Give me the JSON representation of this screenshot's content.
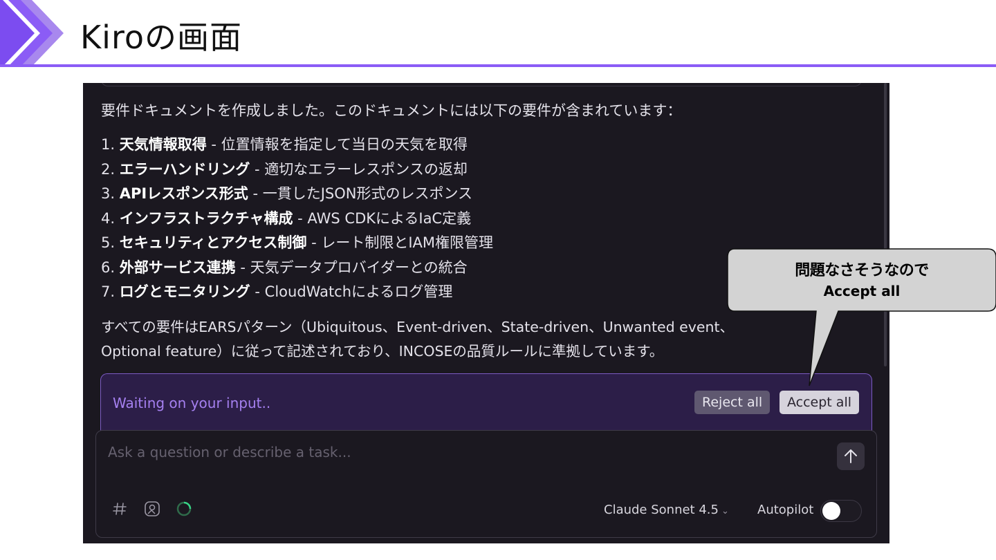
{
  "slide": {
    "title": "Kiroの画面",
    "accent_color": "#8b5cf6"
  },
  "chat": {
    "intro": "要件ドキュメントを作成しました。このドキュメントには以下の要件が含まれています：",
    "requirements": [
      {
        "num": "1.",
        "title": "天気情報取得",
        "desc": " - 位置情報を指定して当日の天気を取得"
      },
      {
        "num": "2.",
        "title": "エラーハンドリング",
        "desc": " - 適切なエラーレスポンスの返却"
      },
      {
        "num": "3.",
        "title": "APIレスポンス形式",
        "desc": " - 一貫したJSON形式のレスポンス"
      },
      {
        "num": "4.",
        "title": "インフラストラクチャ構成",
        "desc": " - AWS CDKによるIaC定義"
      },
      {
        "num": "5.",
        "title": "セキュリティとアクセス制御",
        "desc": " - レート制限とIAM権限管理"
      },
      {
        "num": "6.",
        "title": "外部サービス連携",
        "desc": " - 天気データプロバイダーとの統合"
      },
      {
        "num": "7.",
        "title": "ログとモニタリング",
        "desc": " - CloudWatchによるログ管理"
      }
    ],
    "summary_line1": "すべての要件はEARSパターン（Ubiquitous、Event-driven、State-driven、Unwanted event、",
    "summary_line2": "Optional feature）に従って記述されており、INCOSEの品質ルールに準拠しています。"
  },
  "waiting": {
    "text": "Waiting on your input..",
    "reject_label": "Reject all",
    "accept_label": "Accept all"
  },
  "input": {
    "placeholder": "Ask a question or describe a task...",
    "value": "",
    "send_icon": "arrow-up-icon",
    "tools": [
      "hash-icon",
      "image-icon",
      "spinner-icon"
    ],
    "model": "Claude Sonnet 4.5",
    "autopilot_label": "Autopilot",
    "autopilot_on": false
  },
  "callout": {
    "line1": "問題なさそうなので",
    "line2": "Accept all"
  }
}
